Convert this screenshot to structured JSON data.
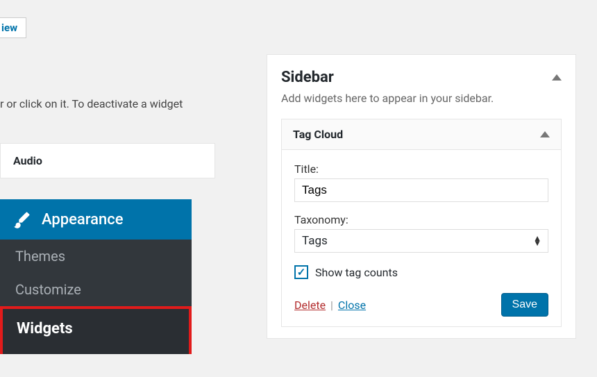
{
  "topButton": {
    "label": "iew"
  },
  "instruction": "r or click on it. To deactivate a widget",
  "availableWidget": {
    "name": "Audio"
  },
  "menu": {
    "section": "Appearance",
    "items": [
      "Themes",
      "Customize",
      "Widgets"
    ]
  },
  "sidebar": {
    "title": "Sidebar",
    "description": "Add widgets here to appear in your sidebar."
  },
  "widget": {
    "name": "Tag Cloud",
    "titleLabel": "Title:",
    "titleValue": "Tags",
    "taxonomyLabel": "Taxonomy:",
    "taxonomyValue": "Tags",
    "checkboxLabel": "Show tag counts",
    "checkboxChecked": true,
    "deleteLabel": "Delete",
    "closeLabel": "Close",
    "saveLabel": "Save"
  }
}
